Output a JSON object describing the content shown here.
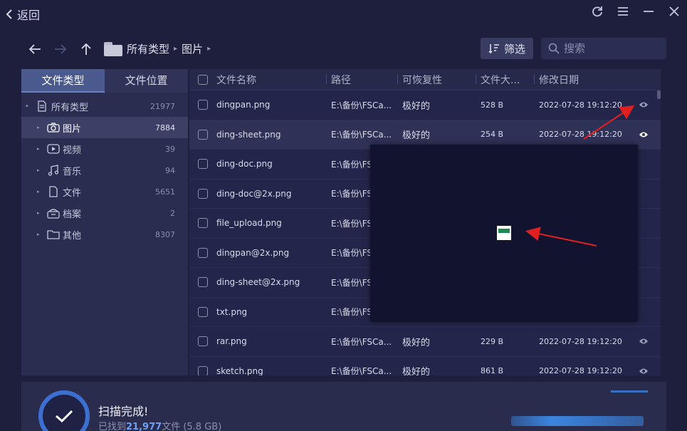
{
  "titlebar": {
    "back_label": "返回"
  },
  "crumbs": {
    "root": "所有类型",
    "current": "图片"
  },
  "toolbar": {
    "filter_label": "筛选",
    "search_placeholder": "搜索"
  },
  "sidebar": {
    "tabs": [
      "文件类型",
      "文件位置"
    ],
    "root": {
      "label": "所有类型",
      "count": "21977"
    },
    "items": [
      {
        "label": "图片",
        "count": "7884",
        "icon": "camera-icon"
      },
      {
        "label": "视频",
        "count": "39",
        "icon": "video-icon"
      },
      {
        "label": "音乐",
        "count": "94",
        "icon": "music-icon"
      },
      {
        "label": "文件",
        "count": "5651",
        "icon": "document-icon"
      },
      {
        "label": "档案",
        "count": "2",
        "icon": "archive-icon"
      },
      {
        "label": "其他",
        "count": "8307",
        "icon": "folder-icon"
      }
    ]
  },
  "table": {
    "headers": [
      "文件名称",
      "路径",
      "可恢复性",
      "文件大...",
      "修改日期"
    ],
    "rows": [
      {
        "name": "dingpan.png",
        "path": "E:\\备份\\FSCa...",
        "cond": "极好的",
        "size": "528 B",
        "date": "2022-07-28 19:12:20"
      },
      {
        "name": "ding-sheet.png",
        "path": "E:\\备份\\FSCa...",
        "cond": "极好的",
        "size": "254 B",
        "date": "2022-07-28 19:12:20"
      },
      {
        "name": "ding-doc.png",
        "path": "E:\\备份\\FS",
        "cond": "",
        "size": "",
        "date": ""
      },
      {
        "name": "ding-doc@2x.png",
        "path": "E:\\备份\\FS",
        "cond": "",
        "size": "",
        "date": ""
      },
      {
        "name": "file_upload.png",
        "path": "E:\\备份\\FS",
        "cond": "",
        "size": "",
        "date": ""
      },
      {
        "name": "dingpan@2x.png",
        "path": "E:\\备份\\FS",
        "cond": "",
        "size": "",
        "date": ""
      },
      {
        "name": "ding-sheet@2x.png",
        "path": "E:\\备份\\FS",
        "cond": "",
        "size": "",
        "date": ""
      },
      {
        "name": "txt.png",
        "path": "E:\\备份\\FS",
        "cond": "",
        "size": "",
        "date": ""
      },
      {
        "name": "rar.png",
        "path": "E:\\备份\\FSCa...",
        "cond": "极好的",
        "size": "229 B",
        "date": "2022-07-28 19:12:20"
      },
      {
        "name": "sketch.png",
        "path": "E:\\备份\\FSCa...",
        "cond": "极好的",
        "size": "861 B",
        "date": "2022-07-28 19:12:20"
      }
    ]
  },
  "status": {
    "title": "扫描完成!",
    "found_prefix": "已找到",
    "found_count": "21,977",
    "found_suffix": "文件 (5.8 GB)"
  },
  "colors": {
    "accent": "#3d6fd1",
    "arrow": "#e02020"
  }
}
